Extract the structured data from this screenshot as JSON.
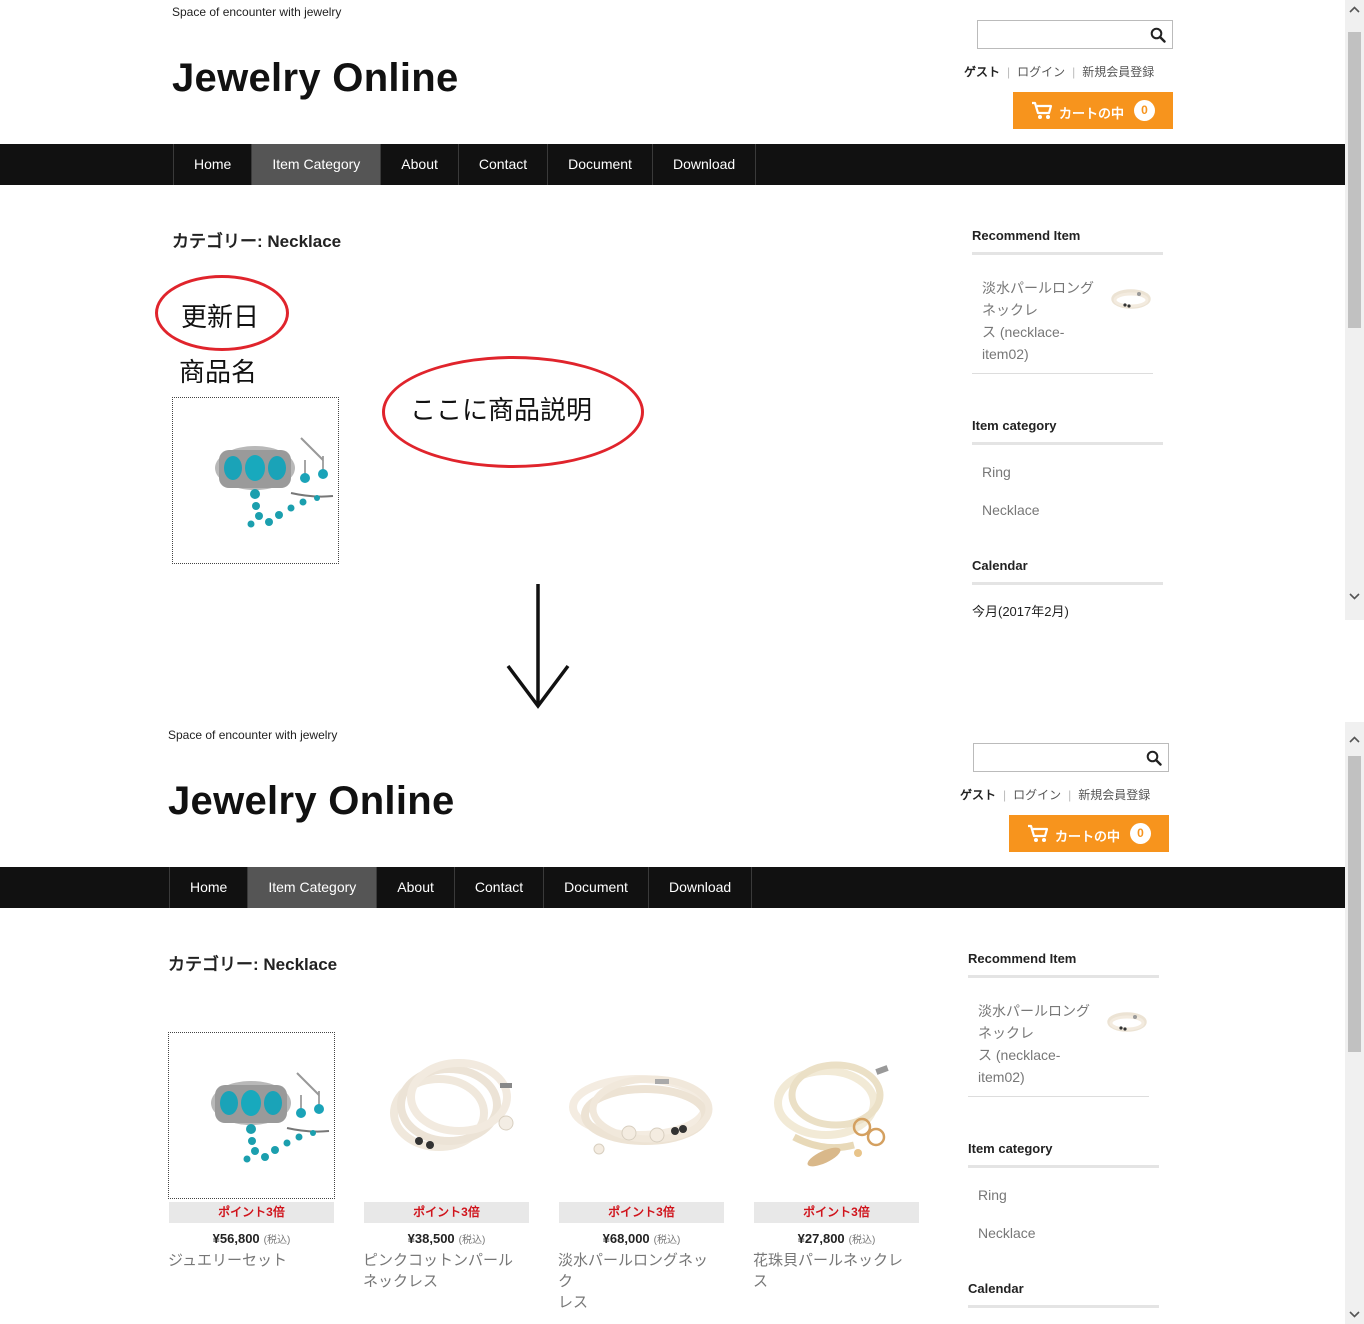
{
  "site": {
    "tagline": "Space of encounter with jewelry",
    "logo": "Jewelry Online",
    "user": {
      "guest": "ゲスト",
      "login": "ログイン",
      "register": "新規会員登録"
    },
    "cart": {
      "label": "カートの中",
      "count": "0"
    }
  },
  "nav": {
    "items": [
      "Home",
      "Item Category",
      "About",
      "Contact",
      "Document",
      "Download"
    ],
    "active": "Item Category"
  },
  "category_title": "カテゴリー: Necklace",
  "sidebar": {
    "recommend_title": "Recommend Item",
    "recommend_item": {
      "line1": "淡水パールロング",
      "line2": "ネックレ",
      "line3": "ス (necklace-",
      "line4": "item02)"
    },
    "category_title": "Item category",
    "categories": [
      "Ring",
      "Necklace"
    ],
    "calendar_title": "Calendar",
    "calendar_month": "今月(2017年2月)"
  },
  "annotations": {
    "update_date": "更新日",
    "product_name": "商品名",
    "description": "ここに商品説明"
  },
  "products": [
    {
      "badge": "ポイント3倍",
      "price": "¥56,800",
      "tax": "(税込)",
      "name_line1": "ジュエリーセット",
      "name_line2": ""
    },
    {
      "badge": "ポイント3倍",
      "price": "¥38,500",
      "tax": "(税込)",
      "name_line1": "ピンクコットンパール",
      "name_line2": "ネックレス"
    },
    {
      "badge": "ポイント3倍",
      "price": "¥68,000",
      "tax": "(税込)",
      "name_line1": "淡水パールロングネック",
      "name_line2": "レス"
    },
    {
      "badge": "ポイント3倍",
      "price": "¥27,800",
      "tax": "(税込)",
      "name_line1": "花珠貝パールネックレス",
      "name_line2": ""
    }
  ],
  "colors": {
    "accent": "#f7941d",
    "nav_bg": "#111111",
    "nav_active": "#555555",
    "annotation": "#e0242c",
    "points_text": "#d0141c"
  }
}
